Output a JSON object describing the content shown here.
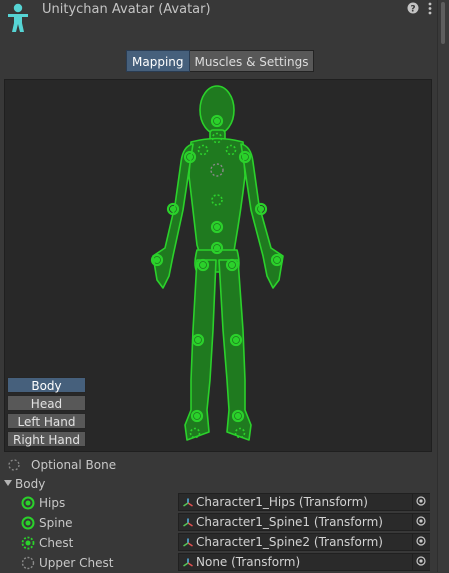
{
  "window": {
    "title": "Unitychan Avatar (Avatar)",
    "icon": "humanoid-avatar-icon",
    "help_icon": "help-icon",
    "menu_icon": "kebab-menu-icon"
  },
  "tabs": [
    {
      "label": "Mapping",
      "active": true
    },
    {
      "label": "Muscles & Settings",
      "active": false
    }
  ],
  "body_parts": [
    {
      "label": "Body",
      "active": true
    },
    {
      "label": "Head",
      "active": false
    },
    {
      "label": "Left Hand",
      "active": false
    },
    {
      "label": "Right Hand",
      "active": false
    }
  ],
  "legend": {
    "optional_bone": "Optional Bone"
  },
  "section": {
    "label": "Body",
    "expanded": true
  },
  "bones": [
    {
      "name": "Hips",
      "value": "Character1_Hips (Transform)",
      "optional": false
    },
    {
      "name": "Spine",
      "value": "Character1_Spine1 (Transform)",
      "optional": false
    },
    {
      "name": "Chest",
      "value": "Character1_Spine2 (Transform)",
      "optional": true
    },
    {
      "name": "Upper Chest",
      "value": "None (Transform)",
      "optional": true
    }
  ],
  "colors": {
    "accent": "#46607c",
    "bone_green": "#2bd12b",
    "figure_fill": "#1f7a1f",
    "background": "#383838"
  }
}
